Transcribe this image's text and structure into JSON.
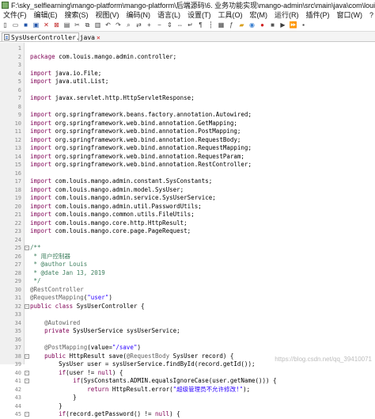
{
  "window": {
    "title": "F:\\sky_selflearning\\mango-platform\\mango-platform\\后端源码\\6. 业务功能实现\\mango-admin\\src\\main\\java\\com\\louis\\mango\\admin\\con"
  },
  "menu": [
    "文件(F)",
    "编辑(E)",
    "搜索(S)",
    "视图(V)",
    "编码(N)",
    "语言(L)",
    "设置(T)",
    "工具(O)",
    "宏(M)",
    "运行(R)",
    "插件(P)",
    "窗口(W)",
    "?"
  ],
  "toolbar": {
    "icons": [
      "new-file-icon",
      "open-file-icon",
      "save-icon",
      "save-all-icon",
      "close-icon",
      "close-all-icon",
      "print-icon",
      "cut-icon",
      "copy-icon",
      "paste-icon",
      "undo-icon",
      "redo-icon",
      "find-icon",
      "replace-icon",
      "zoom-in-icon",
      "zoom-out-icon",
      "sync-v-icon",
      "sync-h-icon",
      "wrap-icon",
      "show-all-icon",
      "indent-guide-icon",
      "doc-map-icon",
      "function-list-icon",
      "folder-icon",
      "monitor-icon",
      "record-icon",
      "stop-icon",
      "play-icon",
      "play-multi-icon",
      "save-macro-icon"
    ]
  },
  "tab": {
    "label": "SysUserController.java",
    "close": "✕"
  },
  "editor": {
    "lines": [
      {
        "n": "1",
        "tokens": []
      },
      {
        "n": "2",
        "tokens": [
          {
            "t": "kw",
            "v": "package"
          },
          {
            "t": "",
            "v": " com.louis.mango.admin.controller;"
          }
        ]
      },
      {
        "n": "3",
        "tokens": []
      },
      {
        "n": "4",
        "tokens": [
          {
            "t": "kw",
            "v": "import"
          },
          {
            "t": "",
            "v": " java.io.File;"
          }
        ]
      },
      {
        "n": "5",
        "tokens": [
          {
            "t": "kw",
            "v": "import"
          },
          {
            "t": "",
            "v": " java.util.List;"
          }
        ]
      },
      {
        "n": "6",
        "tokens": []
      },
      {
        "n": "7",
        "tokens": [
          {
            "t": "kw",
            "v": "import"
          },
          {
            "t": "",
            "v": " javax.servlet.http.HttpServletResponse;"
          }
        ]
      },
      {
        "n": "8",
        "tokens": []
      },
      {
        "n": "9",
        "tokens": [
          {
            "t": "kw",
            "v": "import"
          },
          {
            "t": "",
            "v": " org.springframework.beans.factory.annotation.Autowired;"
          }
        ]
      },
      {
        "n": "10",
        "tokens": [
          {
            "t": "kw",
            "v": "import"
          },
          {
            "t": "",
            "v": " org.springframework.web.bind.annotation.GetMapping;"
          }
        ]
      },
      {
        "n": "11",
        "tokens": [
          {
            "t": "kw",
            "v": "import"
          },
          {
            "t": "",
            "v": " org.springframework.web.bind.annotation.PostMapping;"
          }
        ]
      },
      {
        "n": "12",
        "tokens": [
          {
            "t": "kw",
            "v": "import"
          },
          {
            "t": "",
            "v": " org.springframework.web.bind.annotation.RequestBody;"
          }
        ]
      },
      {
        "n": "13",
        "tokens": [
          {
            "t": "kw",
            "v": "import"
          },
          {
            "t": "",
            "v": " org.springframework.web.bind.annotation.RequestMapping;"
          }
        ]
      },
      {
        "n": "14",
        "tokens": [
          {
            "t": "kw",
            "v": "import"
          },
          {
            "t": "",
            "v": " org.springframework.web.bind.annotation.RequestParam;"
          }
        ]
      },
      {
        "n": "15",
        "tokens": [
          {
            "t": "kw",
            "v": "import"
          },
          {
            "t": "",
            "v": " org.springframework.web.bind.annotation.RestController;"
          }
        ]
      },
      {
        "n": "16",
        "tokens": []
      },
      {
        "n": "17",
        "tokens": [
          {
            "t": "kw",
            "v": "import"
          },
          {
            "t": "",
            "v": " com.louis.mango.admin.constant.SysConstants;"
          }
        ]
      },
      {
        "n": "18",
        "tokens": [
          {
            "t": "kw",
            "v": "import"
          },
          {
            "t": "",
            "v": " com.louis.mango.admin.model.SysUser;"
          }
        ]
      },
      {
        "n": "19",
        "tokens": [
          {
            "t": "kw",
            "v": "import"
          },
          {
            "t": "",
            "v": " com.louis.mango.admin.service.SysUserService;"
          }
        ]
      },
      {
        "n": "20",
        "tokens": [
          {
            "t": "kw",
            "v": "import"
          },
          {
            "t": "",
            "v": " com.louis.mango.admin.util.PasswordUtils;"
          }
        ]
      },
      {
        "n": "21",
        "tokens": [
          {
            "t": "kw",
            "v": "import"
          },
          {
            "t": "",
            "v": " com.louis.mango.common.utils.FileUtils;"
          }
        ]
      },
      {
        "n": "22",
        "tokens": [
          {
            "t": "kw",
            "v": "import"
          },
          {
            "t": "",
            "v": " com.louis.mango.core.http.HttpResult;"
          }
        ]
      },
      {
        "n": "23",
        "tokens": [
          {
            "t": "kw",
            "v": "import"
          },
          {
            "t": "",
            "v": " com.louis.mango.core.page.PageRequest;"
          }
        ]
      },
      {
        "n": "24",
        "tokens": []
      },
      {
        "n": "25",
        "fold": "-",
        "tokens": [
          {
            "t": "cmt",
            "v": "/**"
          }
        ]
      },
      {
        "n": "26",
        "tokens": [
          {
            "t": "cmt",
            "v": " * 用户控制器"
          }
        ]
      },
      {
        "n": "27",
        "tokens": [
          {
            "t": "cmt",
            "v": " * @author Louis"
          }
        ]
      },
      {
        "n": "28",
        "tokens": [
          {
            "t": "cmt",
            "v": " * @date Jan 13, 2019"
          }
        ]
      },
      {
        "n": "29",
        "tokens": [
          {
            "t": "cmt",
            "v": " */"
          }
        ]
      },
      {
        "n": "30",
        "tokens": [
          {
            "t": "ann",
            "v": "@RestController"
          }
        ]
      },
      {
        "n": "31",
        "tokens": [
          {
            "t": "ann",
            "v": "@RequestMapping"
          },
          {
            "t": "",
            "v": "("
          },
          {
            "t": "str",
            "v": "\"user\""
          },
          {
            "t": "",
            "v": ")"
          }
        ]
      },
      {
        "n": "32",
        "fold": "-",
        "tokens": [
          {
            "t": "kw",
            "v": "public class"
          },
          {
            "t": "",
            "v": " SysUserController {"
          }
        ]
      },
      {
        "n": "33",
        "tokens": []
      },
      {
        "n": "34",
        "tokens": [
          {
            "t": "",
            "v": "    "
          },
          {
            "t": "ann",
            "v": "@Autowired"
          }
        ]
      },
      {
        "n": "35",
        "tokens": [
          {
            "t": "",
            "v": "    "
          },
          {
            "t": "kw",
            "v": "private"
          },
          {
            "t": "",
            "v": " SysUserService sysUserService;"
          }
        ]
      },
      {
        "n": "36",
        "tokens": []
      },
      {
        "n": "37",
        "tokens": [
          {
            "t": "",
            "v": "    "
          },
          {
            "t": "ann",
            "v": "@PostMapping"
          },
          {
            "t": "",
            "v": "(value="
          },
          {
            "t": "str",
            "v": "\"/save\""
          },
          {
            "t": "",
            "v": ")"
          }
        ]
      },
      {
        "n": "38",
        "fold": "-",
        "tokens": [
          {
            "t": "",
            "v": "    "
          },
          {
            "t": "kw",
            "v": "public"
          },
          {
            "t": "",
            "v": " HttpResult save("
          },
          {
            "t": "ann",
            "v": "@RequestBody"
          },
          {
            "t": "",
            "v": " SysUser record) {"
          }
        ]
      },
      {
        "n": "39",
        "tokens": [
          {
            "t": "",
            "v": "        SysUser user = sysUserService.findById(record.getId());"
          }
        ]
      },
      {
        "n": "40",
        "fold": "-",
        "tokens": [
          {
            "t": "",
            "v": "        "
          },
          {
            "t": "kw",
            "v": "if"
          },
          {
            "t": "",
            "v": "(user != "
          },
          {
            "t": "kw",
            "v": "null"
          },
          {
            "t": "",
            "v": ") {"
          }
        ]
      },
      {
        "n": "41",
        "fold": "-",
        "tokens": [
          {
            "t": "",
            "v": "            "
          },
          {
            "t": "kw",
            "v": "if"
          },
          {
            "t": "",
            "v": "(SysConstants.ADMIN.equalsIgnoreCase(user.getName())) {"
          }
        ]
      },
      {
        "n": "42",
        "tokens": [
          {
            "t": "",
            "v": "                "
          },
          {
            "t": "kw",
            "v": "return"
          },
          {
            "t": "",
            "v": " HttpResult.error("
          },
          {
            "t": "str",
            "v": "\"超级管理员不允许修改!\""
          },
          {
            "t": "",
            "v": ");"
          }
        ]
      },
      {
        "n": "43",
        "tokens": [
          {
            "t": "",
            "v": "            }"
          }
        ]
      },
      {
        "n": "44",
        "tokens": [
          {
            "t": "",
            "v": "        }"
          }
        ]
      },
      {
        "n": "45",
        "fold": "-",
        "tokens": [
          {
            "t": "",
            "v": "        "
          },
          {
            "t": "kw",
            "v": "if"
          },
          {
            "t": "",
            "v": "(record.getPassword() != "
          },
          {
            "t": "kw",
            "v": "null"
          },
          {
            "t": "",
            "v": ") {"
          }
        ]
      }
    ]
  },
  "watermark": "https://blog.csdn.net/qq_39410071"
}
